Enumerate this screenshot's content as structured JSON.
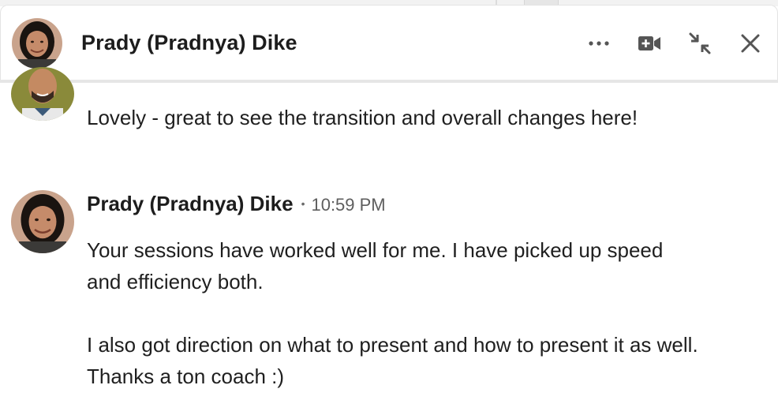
{
  "chat": {
    "contact_name": "Prady (Pradnya) Dike",
    "icons": [
      "more-icon",
      "video-call-icon",
      "minimize-icon",
      "close-icon"
    ]
  },
  "messages": [
    {
      "sender": "",
      "time": "",
      "text": "Lovely - great to see the transition and overall changes here!"
    },
    {
      "sender": "Prady (Pradnya) Dike",
      "separator": "•",
      "time": "10:59 PM",
      "paragraphs": [
        "Your sessions have worked well for me. I have picked up speed and efficiency both.",
        "I also got direction on what to present and how to present it as well. Thanks a ton coach :)"
      ]
    }
  ],
  "colors": {
    "text": "#1d1d1d",
    "muted": "#5e5e5e",
    "icon": "#555555",
    "divider": "#e6e6e6"
  }
}
